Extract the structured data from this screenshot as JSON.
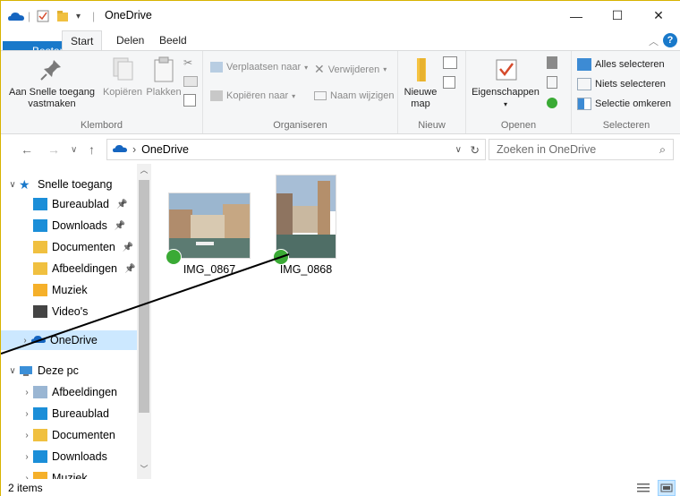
{
  "titlebar": {
    "title": "OneDrive",
    "minimize": "—",
    "maximize": "☐",
    "close": "✕"
  },
  "tabs": {
    "file": "Bestand",
    "start": "Start",
    "share": "Delen",
    "view": "Beeld"
  },
  "ribbon": {
    "clipboard": {
      "label": "Klembord",
      "pin": "Aan Snelle toegang vastmaken",
      "copy": "Kopiëren",
      "paste": "Plakken"
    },
    "organize": {
      "label": "Organiseren",
      "move_to": "Verplaatsen naar",
      "copy_to": "Kopiëren naar",
      "delete": "Verwijderen",
      "rename": "Naam wijzigen"
    },
    "new": {
      "label": "Nieuw",
      "new_folder": "Nieuwe map"
    },
    "open": {
      "label": "Openen",
      "properties": "Eigenschappen"
    },
    "select": {
      "label": "Selecteren",
      "select_all": "Alles selecteren",
      "select_none": "Niets selecteren",
      "invert": "Selectie omkeren"
    }
  },
  "address": {
    "path": "OneDrive",
    "search_placeholder": "Zoeken in OneDrive"
  },
  "nav": {
    "quick_access": "Snelle toegang",
    "quick_items": [
      "Bureaublad",
      "Downloads",
      "Documenten",
      "Afbeeldingen",
      "Muziek",
      "Video's"
    ],
    "onedrive": "OneDrive",
    "this_pc": "Deze pc",
    "pc_items": [
      "Afbeeldingen",
      "Bureaublad",
      "Documenten",
      "Downloads",
      "Muziek"
    ]
  },
  "files": [
    {
      "name": "IMG_0867"
    },
    {
      "name": "IMG_0868"
    }
  ],
  "status": {
    "count": "2 items"
  },
  "colors": {
    "accent": "#1979ca",
    "selection": "#cce8ff",
    "sync_ok": "#3aaa35"
  }
}
